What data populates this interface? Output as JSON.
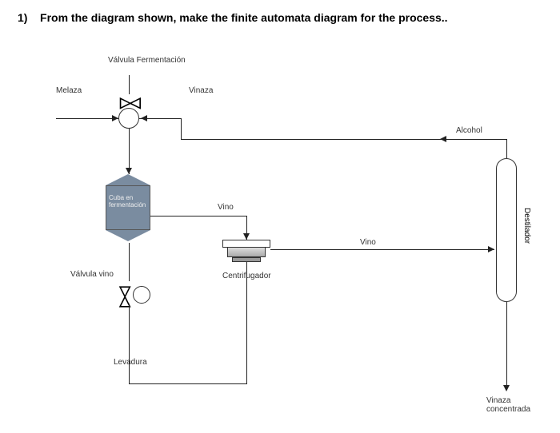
{
  "question": {
    "number": "1)",
    "text": "From the diagram shown, make the finite automata diagram for the process.."
  },
  "labels": {
    "valvula_fermentacion": "Válvula Fermentación",
    "melaza": "Melaza",
    "vinaza": "Vinaza",
    "cuba_en": "Cuba en",
    "fermentacion": "fermentación",
    "valvula_vino": "Válvula vino",
    "levadura": "Levadura",
    "vino1": "Vino",
    "centrifugador": "Centrifugador",
    "vino2": "Vino",
    "alcohol": "Alcohol",
    "destilador": "Destilador",
    "vinaza_concentrada": "Vinaza\nconcentrada"
  },
  "components": {
    "valve_fermentation": "valve-icon",
    "junction": "junction-node",
    "fermentation_tank": "tank",
    "valve_wine": "valve-icon",
    "yeast_node": "circle-node",
    "centrifuge": "centrifuge-unit",
    "distiller": "distiller-column"
  },
  "flows": [
    {
      "from": "Melaza",
      "to": "junction"
    },
    {
      "from": "junction",
      "to": "Vinaza",
      "return": true
    },
    {
      "from": "junction",
      "to": "Cuba en fermentación"
    },
    {
      "from": "Cuba en fermentación",
      "to": "Válvula vino"
    },
    {
      "from": "Válvula vino",
      "to": "Levadura"
    },
    {
      "from": "Levadura",
      "to": "Centrifugador",
      "via": "bottom-path"
    },
    {
      "from": "Centrifugador",
      "label": "Vino",
      "to": "Destilador"
    },
    {
      "from": "Destilador",
      "label": "Alcohol",
      "to": "top-return"
    },
    {
      "from": "Destilador",
      "to": "Vinaza concentrada"
    }
  ]
}
